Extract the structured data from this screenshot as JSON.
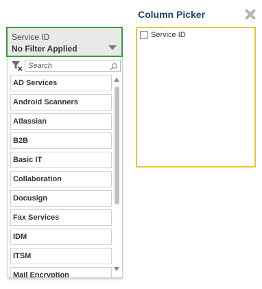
{
  "filter": {
    "label": "Service ID",
    "value": "No Filter Applied",
    "search_placeholder": "Search",
    "items": [
      "AD Services",
      "Android Scanners",
      "Atlassian",
      "B2B",
      "Basic IT",
      "Collaboration",
      "Docusign",
      "Fax Services",
      "IDM",
      "ITSM",
      "Mail Encryption"
    ]
  },
  "column_picker": {
    "title": "Column Picker",
    "columns": [
      {
        "label": "Service ID",
        "checked": false
      }
    ]
  },
  "colors": {
    "filter_border": "#3a9b3a",
    "picker_border": "#f0c330",
    "title": "#1f3f6a"
  }
}
